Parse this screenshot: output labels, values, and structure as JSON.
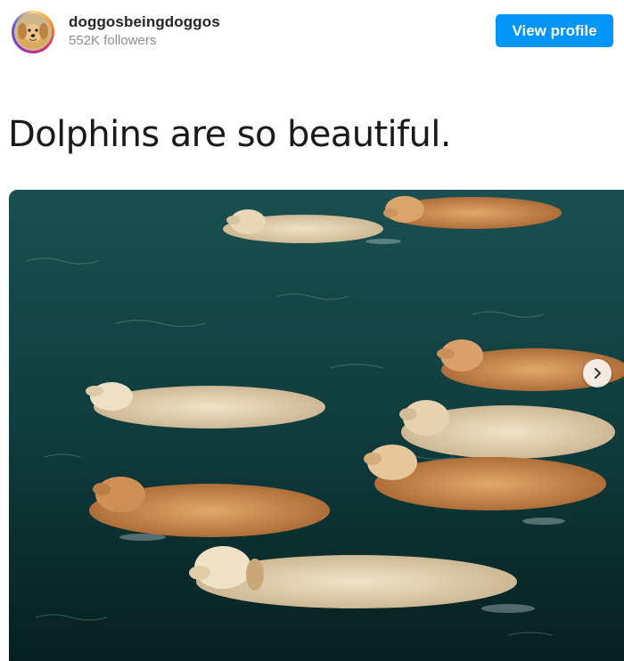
{
  "header": {
    "username": "doggosbeingdoggos",
    "followers": "552K followers",
    "view_profile_label": "View profile"
  },
  "post": {
    "caption": "Dolphins are so beautiful.",
    "photo_subject": "golden retrievers swimming in dark green water"
  },
  "colors": {
    "accent": "#0095f6",
    "water": "#0f3a3b"
  },
  "icons": {
    "carousel_next": "chevron-right-icon"
  }
}
